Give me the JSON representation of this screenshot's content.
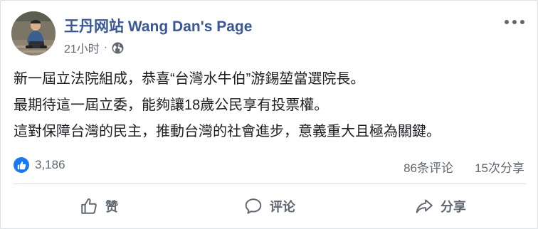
{
  "header": {
    "page_name": "王丹网站 Wang Dan's Page",
    "timestamp": "21小时",
    "separator": "·",
    "privacy_icon": "globe-icon",
    "more_icon": "more-horizontal-icon"
  },
  "post": {
    "lines": [
      "新一屆立法院組成，恭喜“台灣水牛伯”游錫堃當選院長。",
      "最期待這一屆立委，能夠讓18歲公民享有投票權。",
      "這對保障台灣的民主，推動台灣的社會進步，意義重大且極為關鍵。"
    ]
  },
  "stats": {
    "reaction_icon": "like-icon",
    "likes": "3,186",
    "comments": "86条评论",
    "shares": "15次分享"
  },
  "actions": {
    "like_label": "赞",
    "comment_label": "评论",
    "share_label": "分享"
  },
  "colors": {
    "page_name": "#385898",
    "secondary_text": "#606770",
    "like_blue": "#1877f2"
  }
}
